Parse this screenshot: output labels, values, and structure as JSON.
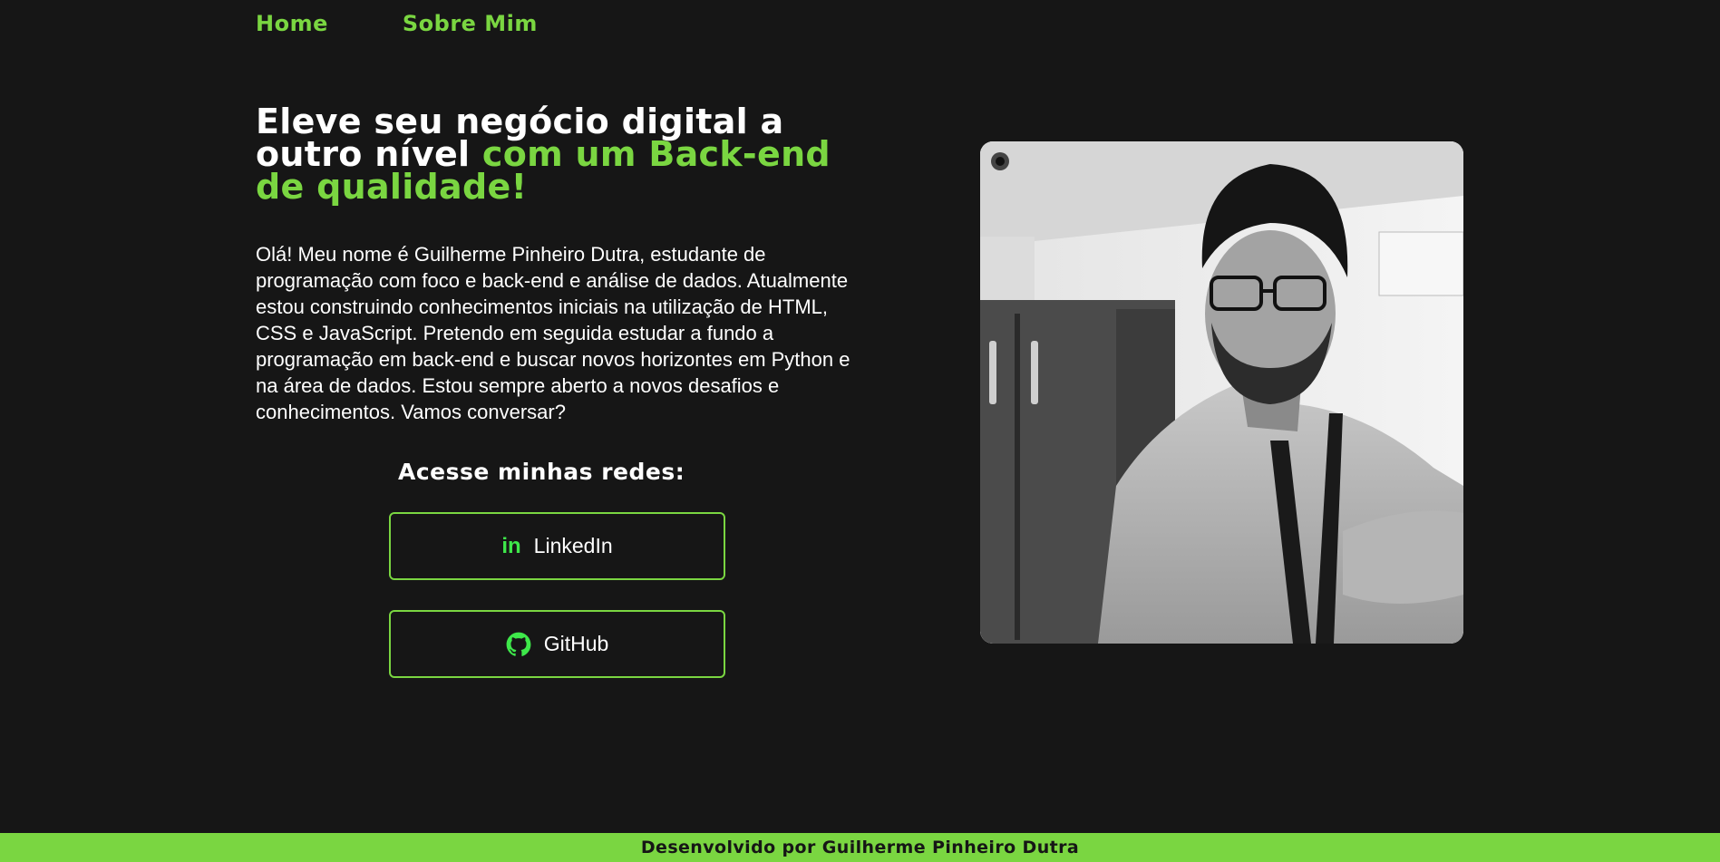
{
  "nav": {
    "home_label": "Home",
    "about_label": "Sobre Mim"
  },
  "hero": {
    "title_part1": "Eleve seu negócio digital a outro nível ",
    "title_accent": "com um Back-end de qualidade!",
    "intro": "Olá! Meu nome é Guilherme Pinheiro Dutra, estudante de programação com foco e back-end e análise de dados. Atualmente estou construindo conhecimentos iniciais na utilização de HTML, CSS e JavaScript. Pretendo em seguida estudar a fundo a programação em back-end e buscar novos horizontes em Python e na área de dados. Estou sempre aberto a novos desafios e conhecimentos. Vamos conversar?"
  },
  "social": {
    "heading": "Acesse minhas redes:",
    "linkedin_label": "LinkedIn",
    "linkedin_icon_glyph": "in",
    "linkedin_icon": "linkedin-icon",
    "github_label": "GitHub",
    "github_icon": "github-icon"
  },
  "photo": {
    "subject": "portrait-photo"
  },
  "footer": {
    "text": "Desenvolvido por Guilherme Pinheiro Dutra"
  },
  "colors": {
    "background": "#161616",
    "accent": "#7ad641",
    "icon_green": "#3ee84a",
    "text": "#ffffff"
  }
}
